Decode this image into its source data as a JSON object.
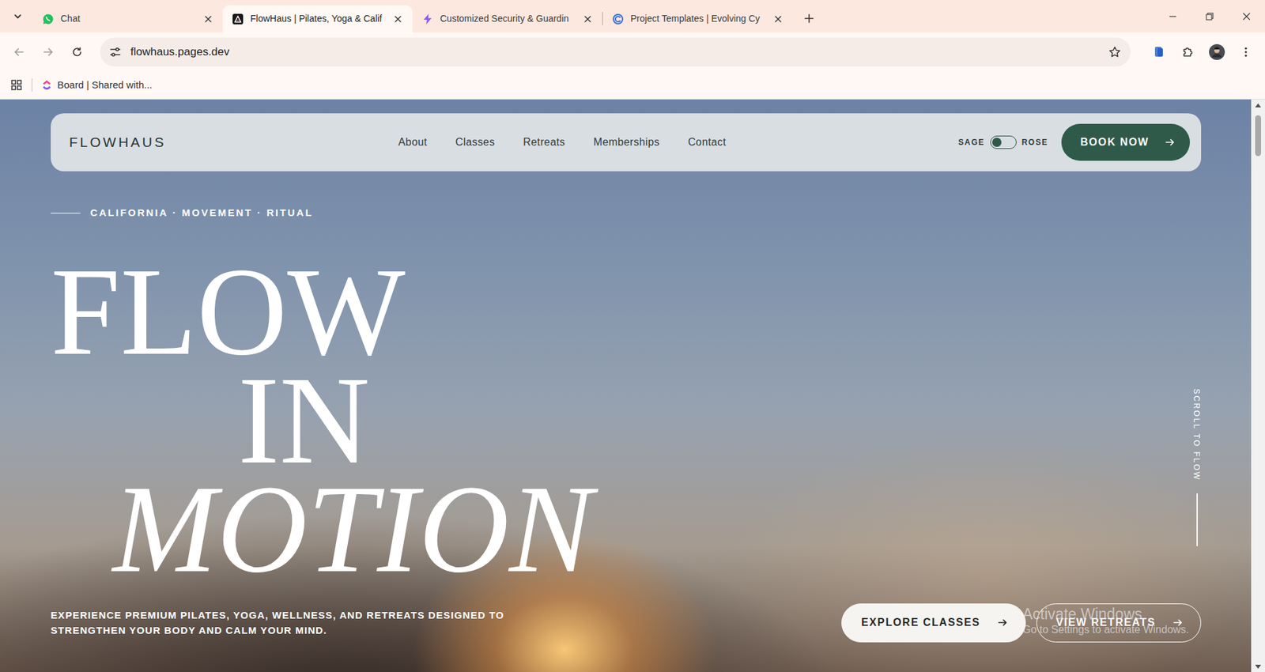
{
  "browser": {
    "tabs": [
      {
        "label": "Chat",
        "selected": false
      },
      {
        "label": "FlowHaus | Pilates, Yoga & Calif",
        "selected": true
      },
      {
        "label": "Customized Security & Guardin",
        "selected": false
      },
      {
        "label": "Project Templates | Evolving Cy",
        "selected": false
      }
    ],
    "address": "flowhaus.pages.dev",
    "bookmarks": [
      {
        "label": "Board | Shared with..."
      }
    ]
  },
  "page": {
    "nav": {
      "logo": "FLOWHAUS",
      "links": [
        "About",
        "Classes",
        "Retreats",
        "Memberships",
        "Contact"
      ],
      "theme_toggle": {
        "left_label": "SAGE",
        "right_label": "ROSE",
        "on": false
      },
      "cta": "BOOK NOW"
    },
    "eyebrow": "CALIFORNIA · MOVEMENT · RITUAL",
    "headline": [
      {
        "text": "FLOW",
        "kind": "plain"
      },
      {
        "text": "IN",
        "kind": "indent"
      },
      {
        "text": "MOTION",
        "kind": "italic"
      }
    ],
    "subtitle": "EXPERIENCE PREMIUM PILATES, YOGA, WELLNESS, AND RETREATS DESIGNED TO STRENGTHEN YOUR BODY AND CALM YOUR MIND.",
    "buttons": [
      {
        "label": "EXPLORE CLASSES",
        "kind": "solid"
      },
      {
        "label": "VIEW RETREATS",
        "kind": "outline"
      }
    ],
    "scroll_hint": "SCROLL TO FLOW"
  },
  "watermark": {
    "title": "Activate Windows",
    "text": "Go to Settings to activate Windows."
  }
}
